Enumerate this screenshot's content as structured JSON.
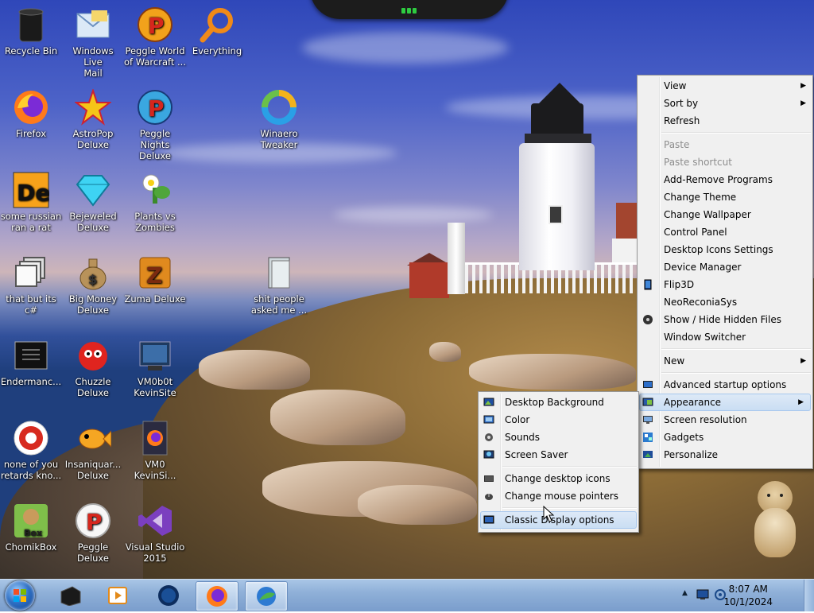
{
  "desktop_icons": [
    {
      "label": "Recycle Bin",
      "icon": "recycle-bin-icon"
    },
    {
      "label": "Windows Live\nMail",
      "icon": "mail-icon"
    },
    {
      "label": "Peggle World\nof Warcraft ...",
      "icon": "peggle-icon"
    },
    {
      "label": "Everything",
      "icon": "magnifier-icon"
    },
    {
      "label": "Firefox",
      "icon": "firefox-icon"
    },
    {
      "label": "AstroPop\nDeluxe",
      "icon": "astropop-icon"
    },
    {
      "label": "Peggle Nights\nDeluxe",
      "icon": "peggle-icon"
    },
    {
      "label": "Winaero\nTweaker",
      "icon": "winaero-icon"
    },
    {
      "label": "some russian\nran a rat",
      "icon": "de-icon"
    },
    {
      "label": "Bejeweled\nDeluxe",
      "icon": "gem-icon"
    },
    {
      "label": "Plants vs\nZombies",
      "icon": "plant-icon"
    },
    {
      "label": "that but its c#",
      "icon": "windows-stack-icon"
    },
    {
      "label": "Big Money\nDeluxe",
      "icon": "money-bag-icon"
    },
    {
      "label": "Zuma Deluxe",
      "icon": "zuma-icon"
    },
    {
      "label": "shit people\nasked me ...",
      "icon": "folder-icon"
    },
    {
      "label": "Endermanc...",
      "icon": "console-icon"
    },
    {
      "label": "Chuzzle\nDeluxe",
      "icon": "chuzzle-icon"
    },
    {
      "label": "VM0b0t\nKevinSite",
      "icon": "vm-icon"
    },
    {
      "label": "none of you\nretards kno...",
      "icon": "red-app-icon"
    },
    {
      "label": "Insaniquar...\nDeluxe",
      "icon": "fish-icon"
    },
    {
      "label": "VM0\nKevinSi...",
      "icon": "firefox-file-icon"
    },
    {
      "label": "ChomikBox",
      "icon": "chomikbox-icon"
    },
    {
      "label": "Peggle Deluxe",
      "icon": "peggle-icon"
    },
    {
      "label": "Visual Studio\n2015",
      "icon": "visual-studio-icon"
    }
  ],
  "context_menu": {
    "items": [
      {
        "label": "View",
        "type": "submenu"
      },
      {
        "label": "Sort by",
        "type": "submenu"
      },
      {
        "label": "Refresh",
        "type": "item"
      },
      {
        "type": "separator"
      },
      {
        "label": "Paste",
        "type": "disabled"
      },
      {
        "label": "Paste shortcut",
        "type": "disabled"
      },
      {
        "label": "Add-Remove Programs",
        "type": "item"
      },
      {
        "label": "Change Theme",
        "type": "item"
      },
      {
        "label": "Change Wallpaper",
        "type": "item"
      },
      {
        "label": "Control Panel",
        "type": "item"
      },
      {
        "label": "Desktop Icons Settings",
        "type": "item"
      },
      {
        "label": "Device Manager",
        "type": "item"
      },
      {
        "label": "Flip3D",
        "type": "item",
        "icon": "flip3d-icon"
      },
      {
        "label": "NeoReconiaSys",
        "type": "item"
      },
      {
        "label": "Show / Hide Hidden Files",
        "type": "item",
        "icon": "disc-icon"
      },
      {
        "label": "Window Switcher",
        "type": "item"
      },
      {
        "type": "separator"
      },
      {
        "label": "New",
        "type": "submenu"
      },
      {
        "type": "separator"
      },
      {
        "label": "Advanced startup options",
        "type": "item",
        "icon": "monitor-icon"
      },
      {
        "label": "Appearance",
        "type": "submenu-active",
        "icon": "appearance-icon"
      },
      {
        "label": "Screen resolution",
        "type": "item",
        "icon": "screen-icon"
      },
      {
        "label": "Gadgets",
        "type": "item",
        "icon": "gadgets-icon"
      },
      {
        "label": "Personalize",
        "type": "item",
        "icon": "personalize-icon"
      }
    ]
  },
  "appearance_submenu": {
    "items": [
      {
        "label": "Desktop Background",
        "type": "item",
        "icon": "desktop-background-icon"
      },
      {
        "label": "Color",
        "type": "item",
        "icon": "color-icon"
      },
      {
        "label": "Sounds",
        "type": "item",
        "icon": "sounds-icon"
      },
      {
        "label": "Screen Saver",
        "type": "item",
        "icon": "screen-saver-icon"
      },
      {
        "type": "separator"
      },
      {
        "label": "Change desktop icons",
        "type": "item",
        "icon": "desktop-icons-icon"
      },
      {
        "label": "Change mouse pointers",
        "type": "item",
        "icon": "mouse-icon"
      },
      {
        "type": "separator"
      },
      {
        "label": "Classic Display options",
        "type": "highlighted",
        "icon": "classic-display-icon"
      }
    ]
  },
  "taskbar": {
    "buttons": [
      {
        "name": "blackbox-icon"
      },
      {
        "name": "media-player-icon"
      },
      {
        "name": "globe-icon"
      },
      {
        "name": "firefox-icon",
        "active": true
      },
      {
        "name": "internet-download-icon",
        "active": true
      }
    ],
    "clock_time": "8:07 AM",
    "clock_date": "10/1/2024",
    "tray_icons": [
      "show-hidden-icons-icon",
      "display-icon",
      "network-icon"
    ]
  },
  "colors": {
    "menu_bg": "#f0f0f0",
    "menu_highlight": "#cadef3",
    "taskbar": "#8fb0d8"
  }
}
